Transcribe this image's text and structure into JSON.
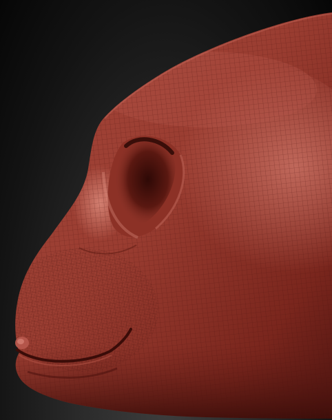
{
  "scene": {
    "subject": "sculpted-head-nose-mouth",
    "colors": {
      "background_dark": "#0a0a0a",
      "background_light": "#3a3a3a",
      "skin_base": "#8e3026",
      "skin_highlight": "#c9695c",
      "skin_shadow": "#3c0f0b",
      "wireframe": "#4a120d"
    },
    "wireframe_visible": true
  }
}
